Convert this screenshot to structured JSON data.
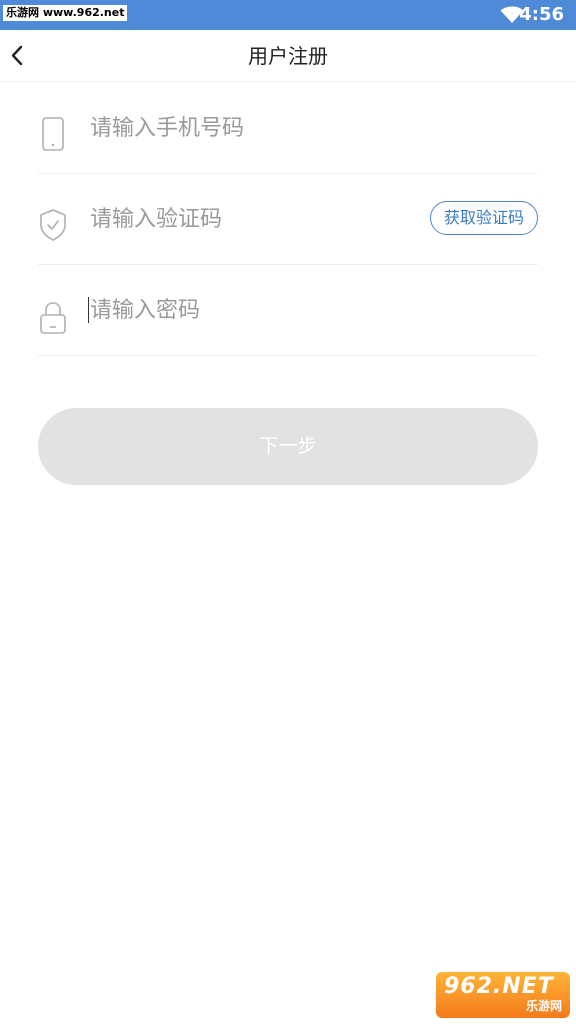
{
  "status_bar": {
    "watermark_text": "乐游网 www.962.net",
    "time": "4:56",
    "wifi_icon": "wifi-icon",
    "background_color": "#4f8ad8"
  },
  "app_bar": {
    "back_icon": "chevron-left-icon",
    "title": "用户注册"
  },
  "form": {
    "phone": {
      "icon": "phone-icon",
      "placeholder": "请输入手机号码",
      "value": ""
    },
    "code": {
      "icon": "shield-check-icon",
      "placeholder": "请输入验证码",
      "value": "",
      "get_code_label": "获取验证码",
      "accent_color": "#3a7bc4"
    },
    "password": {
      "icon": "lock-icon",
      "placeholder": "请输入密码",
      "value": ""
    }
  },
  "next_button": {
    "label": "下一步",
    "background_color": "#e2e2e2",
    "enabled": false
  },
  "bottom_watermark": {
    "logo_text": "962.NET",
    "logo_caption": "乐游网"
  }
}
